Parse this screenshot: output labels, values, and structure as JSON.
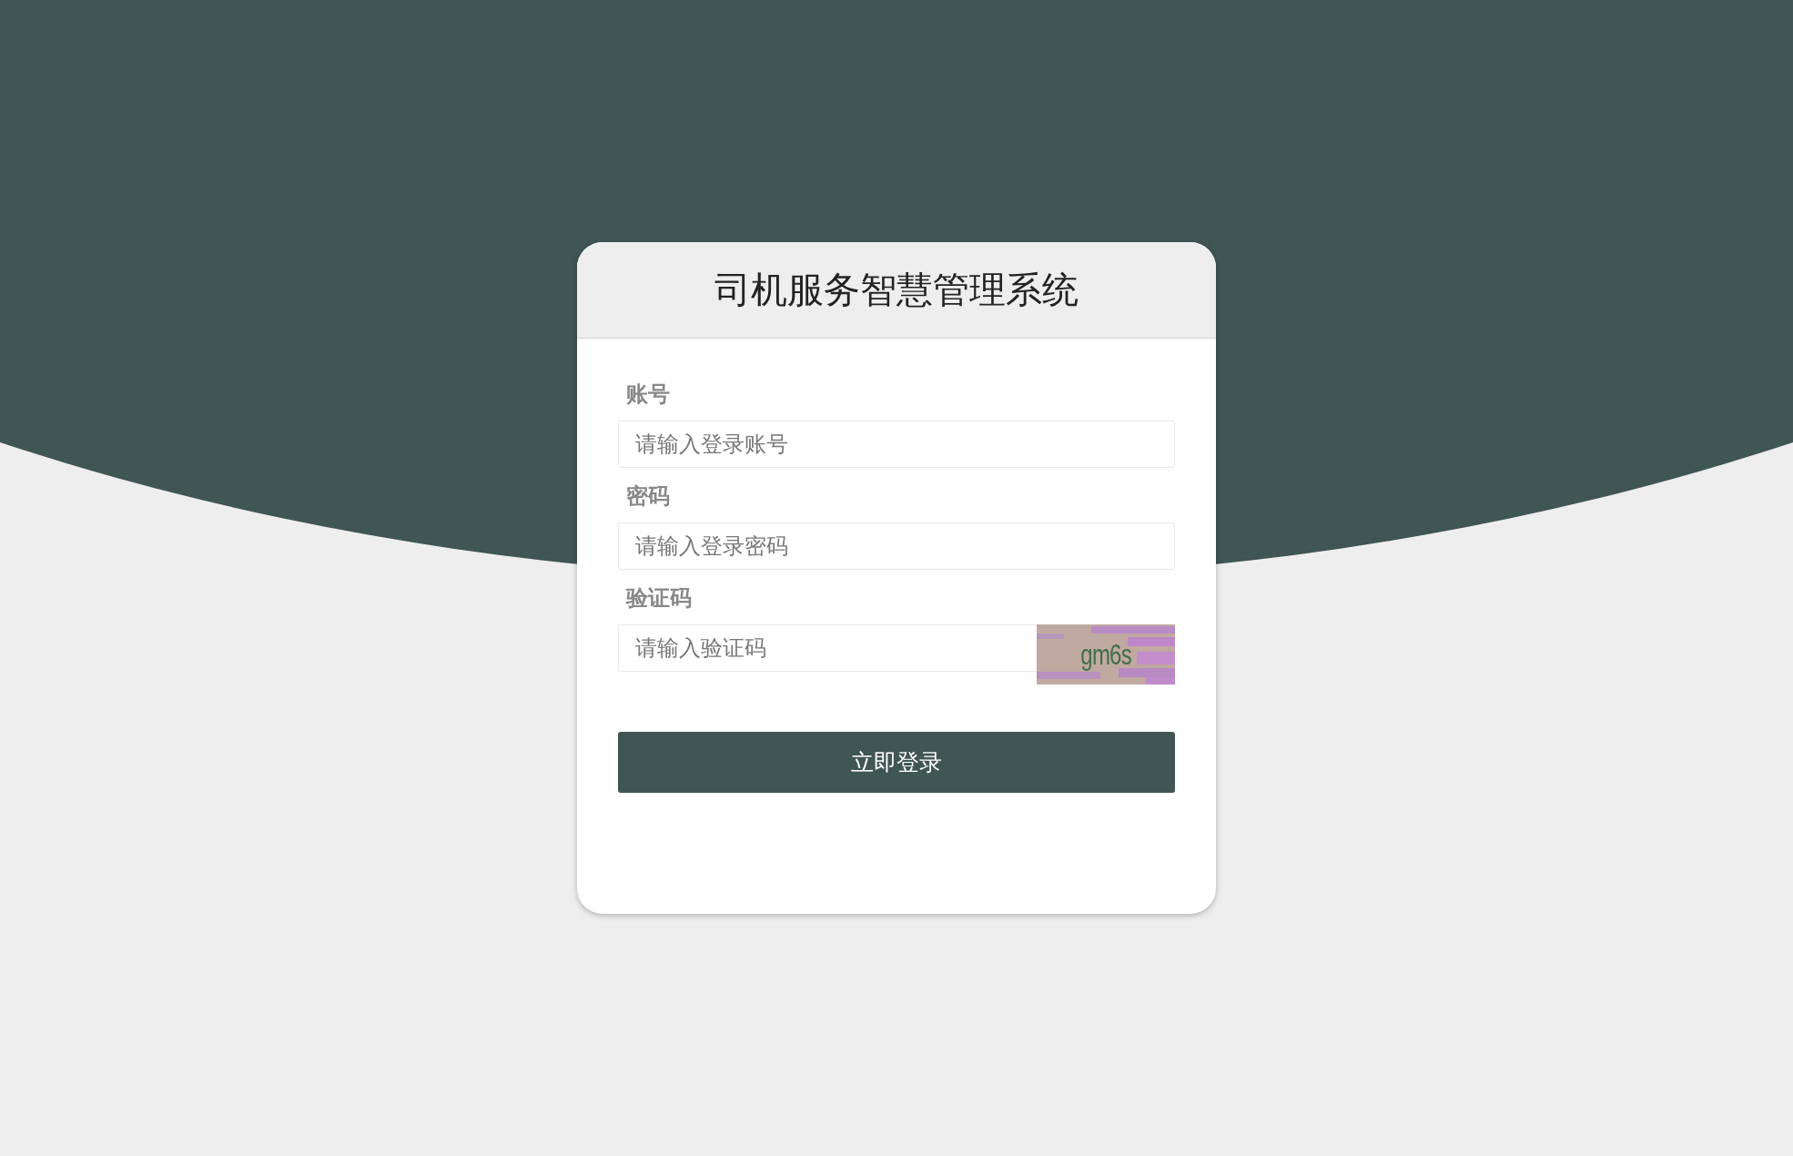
{
  "title": "司机服务智慧管理系统",
  "fields": [
    {
      "label": "账号",
      "placeholder": "请输入登录账号",
      "kind": "text"
    },
    {
      "label": "密码",
      "placeholder": "请输入登录密码",
      "kind": "password"
    },
    {
      "label": "验证码",
      "placeholder": "请输入验证码",
      "kind": "captcha",
      "captcha": "gm6s"
    }
  ],
  "submit": "立即登录"
}
